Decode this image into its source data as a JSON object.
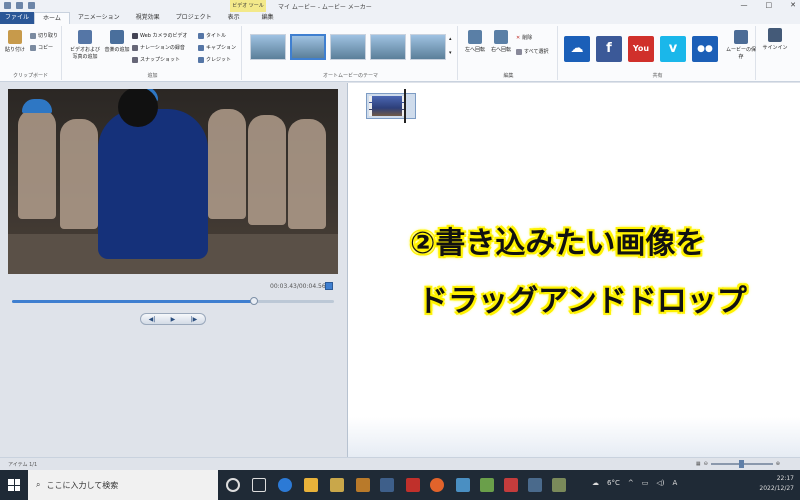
{
  "titlebar": {
    "context_tab": "ビデオ ツール",
    "app_title": "マイ ムービー - ムービー メーカー",
    "window_buttons": [
      "—",
      "□",
      "✕"
    ]
  },
  "tabs": [
    "ファイル",
    "ホーム",
    "アニメーション",
    "視覚効果",
    "プロジェクト",
    "表示",
    "編集"
  ],
  "ribbon": {
    "clipboard": {
      "group_label": "クリップボード",
      "paste": "貼り付け",
      "cut": "切り取り",
      "copy": "コピー"
    },
    "add": {
      "group_label": "追加",
      "add_videos_photos": "ビデオおよび写真の追加",
      "add_music": "音楽の追加",
      "webcam": "Web カメラのビデオ",
      "narration": "ナレーションの録音",
      "snapshot": "スナップショット",
      "title": "タイトル",
      "caption": "キャプション",
      "credits": "クレジット"
    },
    "themes": {
      "group_label": "オートムービーのテーマ"
    },
    "editing": {
      "group_label": "編集",
      "rotate_left": "左へ回転",
      "rotate_right": "右へ回転",
      "delete": "削除",
      "select_all": "すべて選択"
    },
    "share": {
      "group_label": "共有",
      "save_movie": "ムービーの保存",
      "sign_in": "サインイン"
    }
  },
  "share_icons": [
    {
      "name": "onedrive",
      "label": "☁",
      "color": "#1b5fb8"
    },
    {
      "name": "facebook",
      "label": "f",
      "color": "#3b5998"
    },
    {
      "name": "youtube",
      "label": "You",
      "color": "#d0302b"
    },
    {
      "name": "vimeo",
      "label": "v",
      "color": "#1ab7ea"
    },
    {
      "name": "flickr",
      "label": "●●",
      "color": "#1c5fb7"
    }
  ],
  "preview": {
    "time_display": "00:03.43/00:04.56",
    "progress_fraction": 0.75,
    "controls": {
      "prev": "◀|",
      "play": "▶",
      "next": "|▶"
    }
  },
  "overlay": {
    "line1": "②書き込みたい画像を",
    "line2": "ドラッグアンドドロップ"
  },
  "statusbar": {
    "items": "アイテム 1/1"
  },
  "taskbar": {
    "search_placeholder": "ここに入力して検索",
    "temperature": "6°C",
    "ime": "A",
    "time": "22:17",
    "date": "2022/12/27"
  },
  "colors": {
    "accent": "#3f7fd0",
    "file_tab": "#2b5797",
    "highlight": "#fff200"
  }
}
